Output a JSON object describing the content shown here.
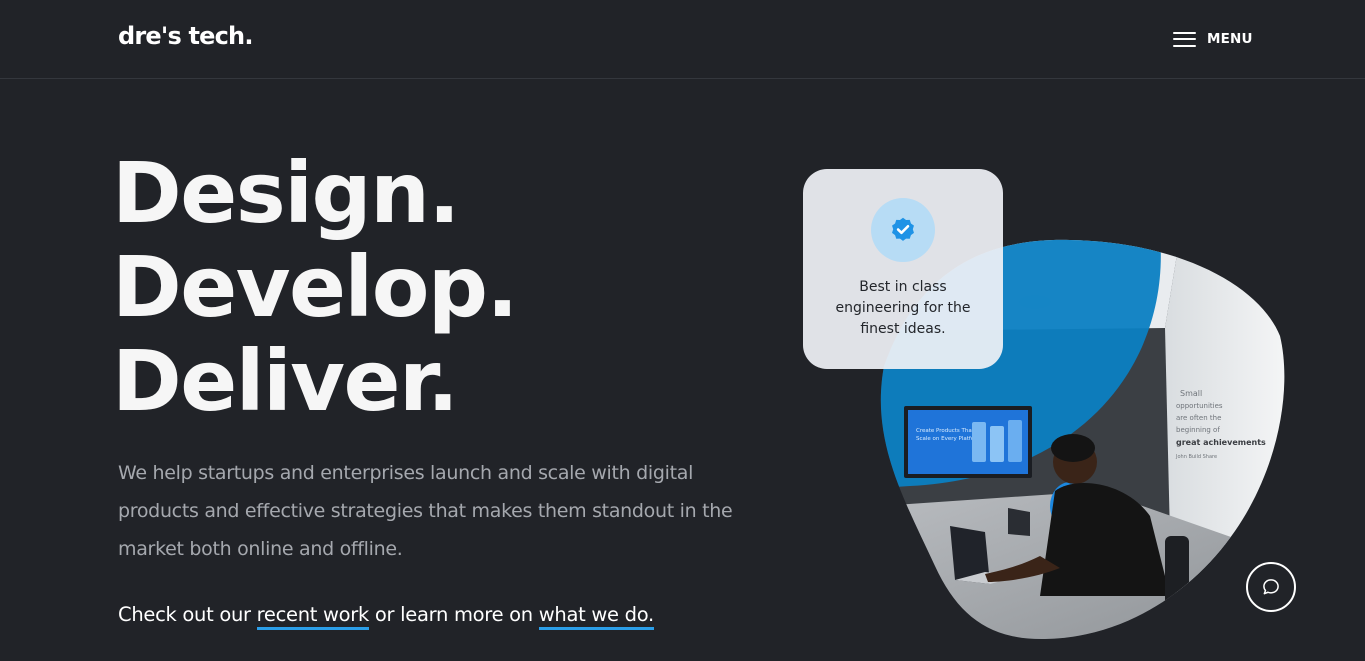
{
  "header": {
    "logo": "dre's tech.",
    "menu_label": "MENU"
  },
  "hero": {
    "headline": [
      "Design.",
      "Develop.",
      "Deliver."
    ],
    "lead": "We help startups and enterprises launch and scale with digital products and effective strategies that makes them standout in the market both online and offline.",
    "cta": {
      "prefix": "Check out our ",
      "link1": "recent work",
      "middle": " or learn more on ",
      "link2": "what we do."
    }
  },
  "card": {
    "icon": "verified-badge-icon",
    "text": "Best in class engineering for the finest ideas."
  },
  "photo": {
    "screen_title": "Create Products That Scale on Every Platform",
    "wall_quote": "Small opportunities are often the beginning of great achievements",
    "wall_author": "John Build Share"
  },
  "chat": {
    "icon": "chat-bubble-icon"
  },
  "colors": {
    "background": "#212328",
    "accent": "#2b9ee8",
    "card": "#eff1f6",
    "muted_text": "#a5a8ae"
  }
}
